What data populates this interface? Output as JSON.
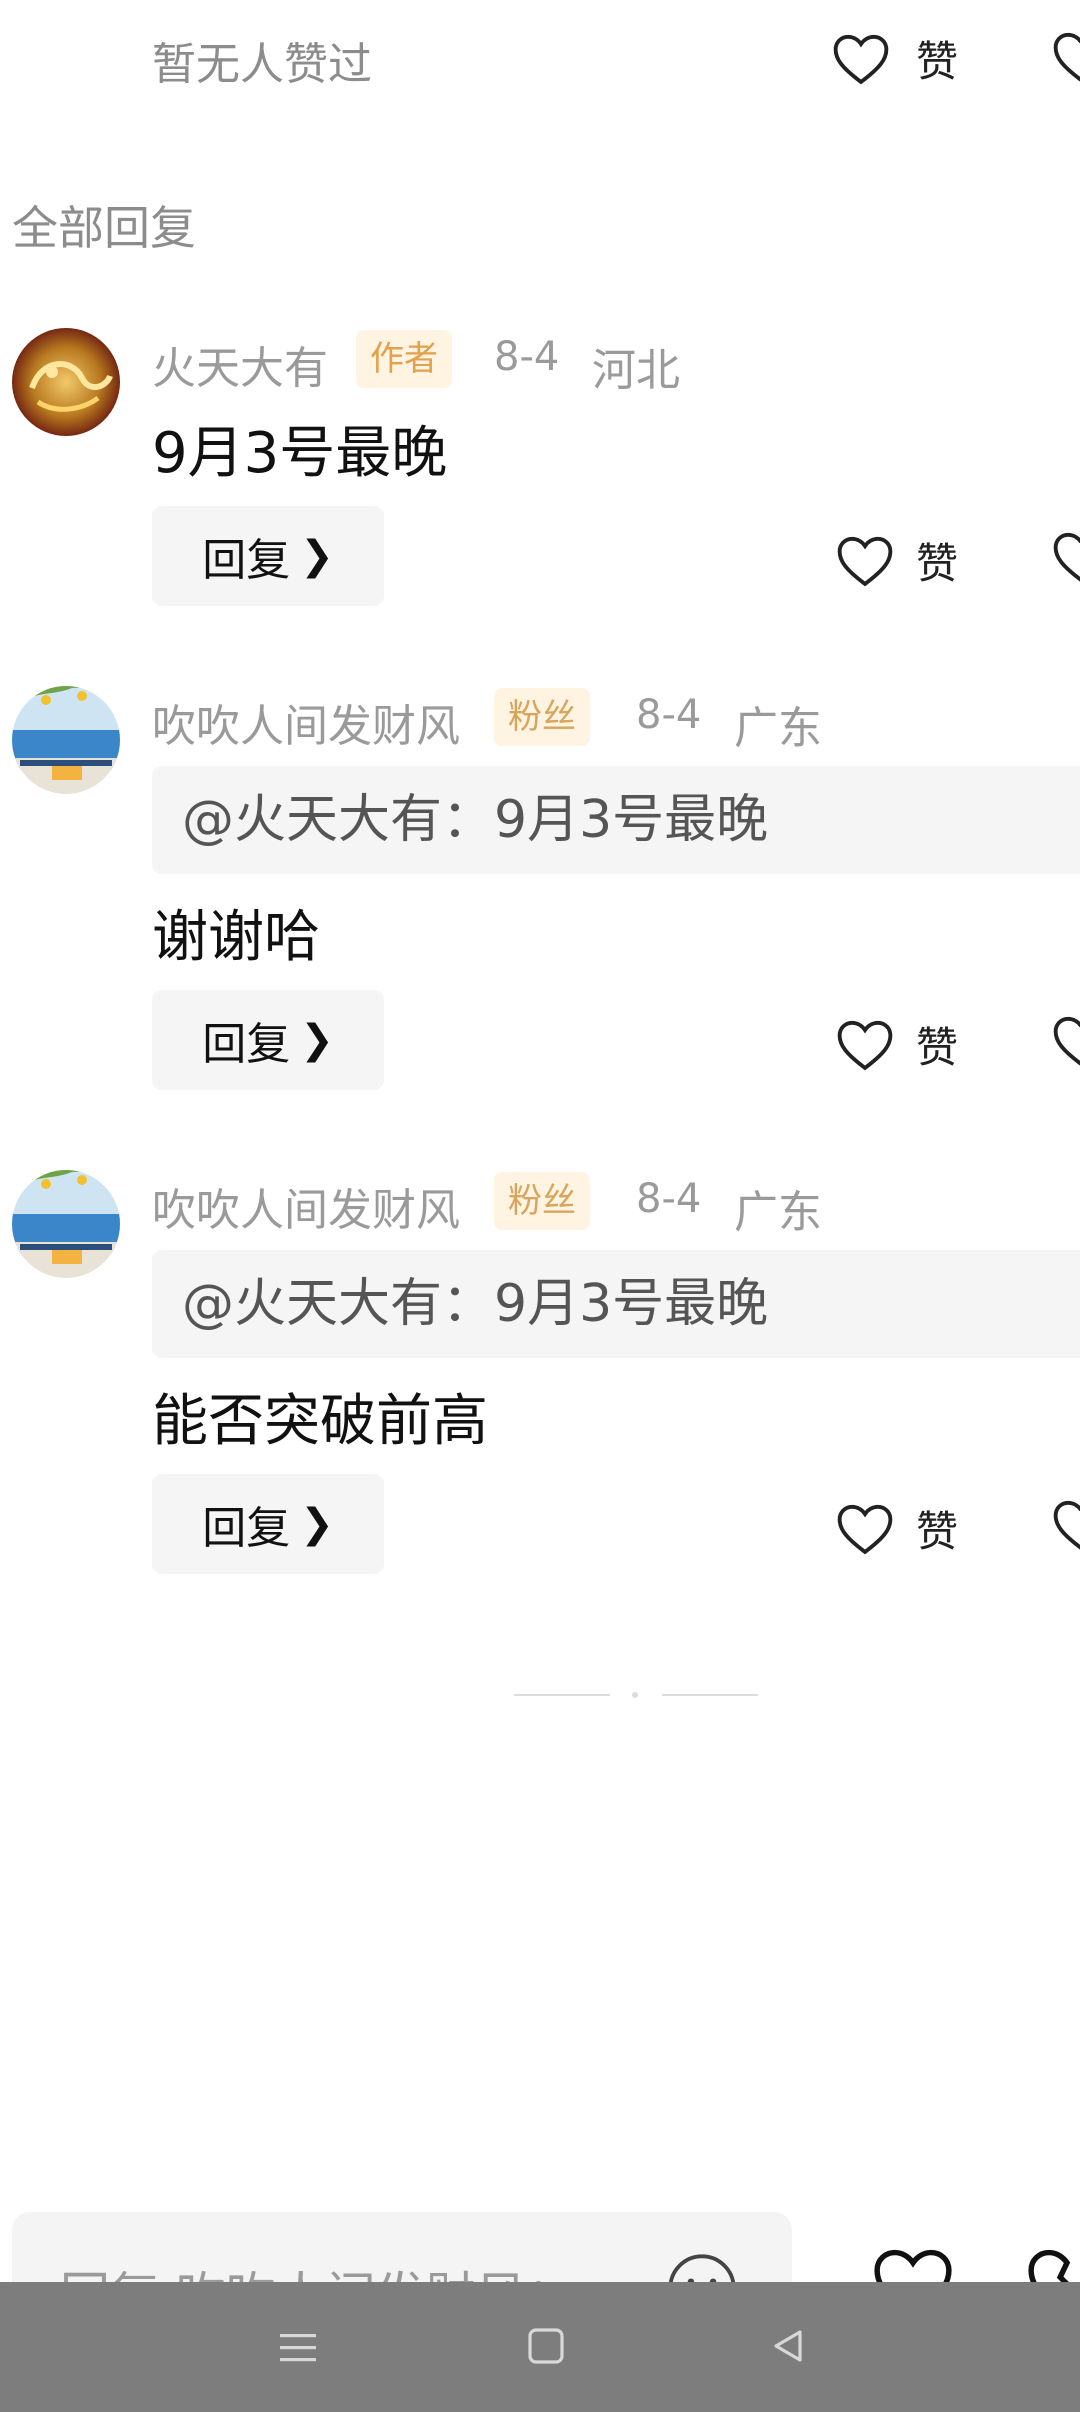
{
  "top": {
    "no_likes_text": "暂无人赞过",
    "like_label": "赞"
  },
  "section_title": "全部回复",
  "comments": [
    {
      "username": "火天大有",
      "badge": "作者",
      "date": "8-4",
      "region": "河北",
      "quote": "",
      "content": "9月3号最晚",
      "reply_label": "回复",
      "like_label": "赞"
    },
    {
      "username": "吹吹人间发财风",
      "badge": "粉丝",
      "date": "8-4",
      "region": "广东",
      "quote": "@火天大有：9月3号最晚",
      "content": "谢谢哈",
      "reply_label": "回复",
      "like_label": "赞"
    },
    {
      "username": "吹吹人间发财风",
      "badge": "粉丝",
      "date": "8-4",
      "region": "广东",
      "quote": "@火天大有：9月3号最晚",
      "content": "能否突破前高",
      "reply_label": "回复",
      "like_label": "赞"
    }
  ],
  "input": {
    "placeholder": "回复 吹吹人间发财风："
  },
  "icons": {
    "heart": "heart-icon",
    "emoji": "emoji-icon",
    "nav_menu": "menu-icon",
    "nav_home": "square-icon",
    "nav_back": "back-triangle-icon"
  },
  "colors": {
    "badge_bg": "#fff3e2",
    "badge_text": "#e1a24a",
    "nav_bar": "#7d7d7d"
  }
}
